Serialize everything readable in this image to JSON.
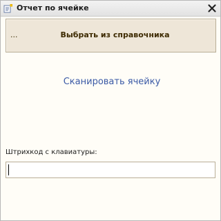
{
  "window": {
    "title": "Отчет по ячейке",
    "title_icon": "form-icon",
    "close_icon": "close-icon"
  },
  "select_panel": {
    "ellipsis": "...",
    "label": "Выбрать из справочника"
  },
  "scan": {
    "label": "Сканировать ячейку"
  },
  "barcode": {
    "label": "Штрихкод с клавиатуры:",
    "value": "",
    "placeholder": ""
  },
  "colors": {
    "background": "#fffdf7",
    "panel": "#eee6d8",
    "link": "#3b5aa6",
    "border": "#b9ae97"
  }
}
